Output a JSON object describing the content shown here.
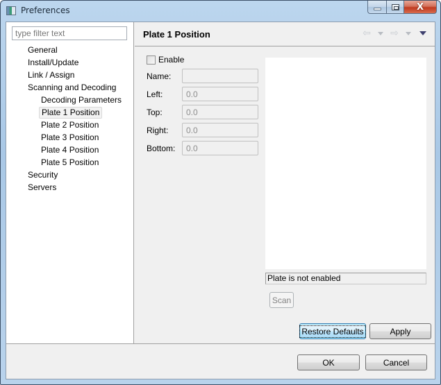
{
  "window": {
    "title": "Preferences",
    "icon": "preferences-app-icon",
    "controls": {
      "minimize": "minimize-icon",
      "maximize": "maximize-icon",
      "close": "close-icon",
      "close_glyph": "X"
    }
  },
  "sidebar": {
    "filter_placeholder": "type filter text",
    "filter_value": "",
    "items": [
      {
        "label": "General",
        "level": 1
      },
      {
        "label": "Install/Update",
        "level": 1
      },
      {
        "label": "Link / Assign",
        "level": 1
      },
      {
        "label": "Scanning and Decoding",
        "level": 1
      },
      {
        "label": "Decoding Parameters",
        "level": 2
      },
      {
        "label": "Plate 1 Position",
        "level": 2,
        "selected": true
      },
      {
        "label": "Plate 2 Position",
        "level": 2
      },
      {
        "label": "Plate 3 Position",
        "level": 2
      },
      {
        "label": "Plate 4 Position",
        "level": 2
      },
      {
        "label": "Plate 5 Position",
        "level": 2
      },
      {
        "label": "Security",
        "level": 1
      },
      {
        "label": "Servers",
        "level": 1
      }
    ]
  },
  "page": {
    "title": "Plate 1 Position",
    "nav": {
      "back": "⇦",
      "forward": "⇨",
      "back_icon": "back-arrow-icon",
      "forward_icon": "forward-arrow-icon",
      "menu_icon": "view-menu-icon"
    },
    "enable": {
      "label": "Enable",
      "checked": false
    },
    "fields": [
      {
        "label": "Name:",
        "value": ""
      },
      {
        "label": "Left:",
        "value": "0.0"
      },
      {
        "label": "Top:",
        "value": "0.0"
      },
      {
        "label": "Right:",
        "value": "0.0"
      },
      {
        "label": "Bottom:",
        "value": "0.0"
      }
    ],
    "status_text": "Plate is not enabled",
    "scan_label": "Scan",
    "restore_defaults_label": "Restore Defaults",
    "apply_label": "Apply"
  },
  "dialog": {
    "ok_label": "OK",
    "cancel_label": "Cancel"
  }
}
